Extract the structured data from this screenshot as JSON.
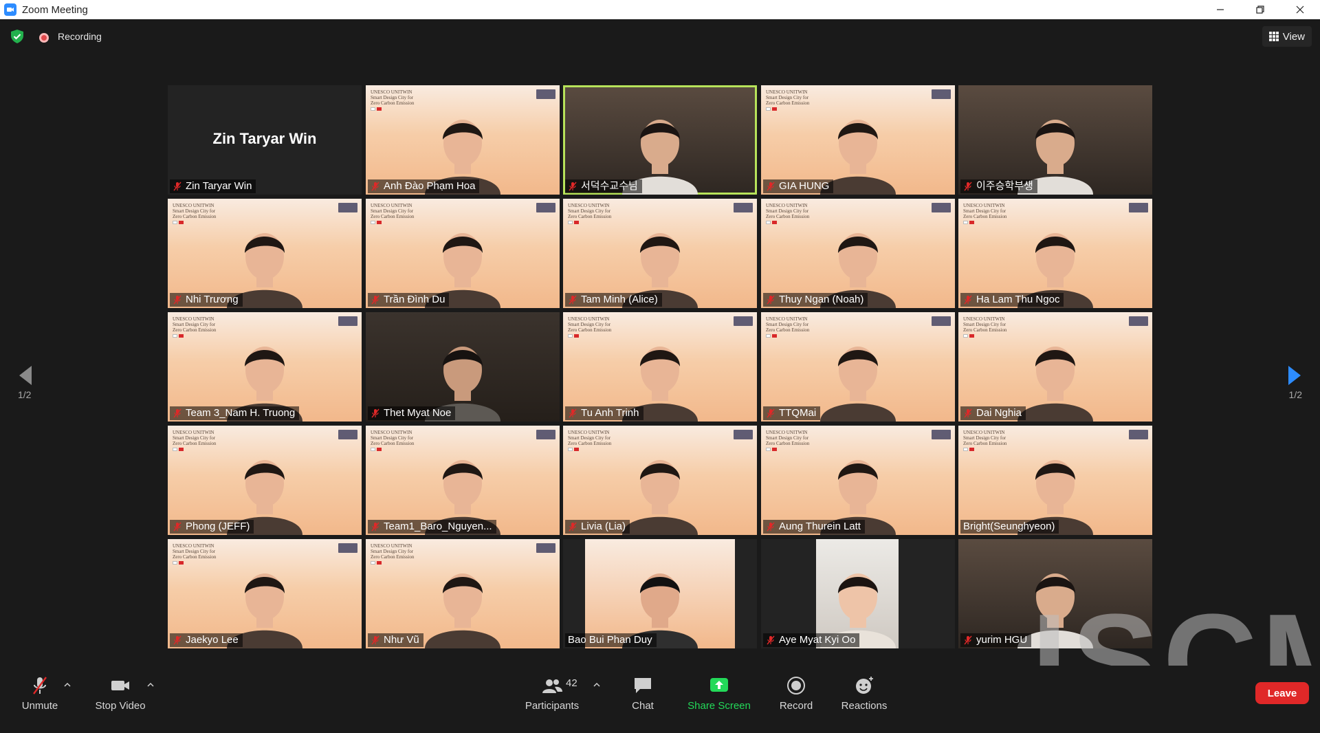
{
  "window": {
    "title": "Zoom Meeting"
  },
  "top": {
    "recording_label": "Recording",
    "view_label": "View"
  },
  "slide_text": "UNESCO UNITWIN\nSmart Design City for\nZero Carbon Emission",
  "pagination": {
    "left": "1/2",
    "right": "1/2"
  },
  "tiles": [
    {
      "name": "Zin Taryar Win",
      "kind": "name-only"
    },
    {
      "name": "Anh Đào Phạm Hoa",
      "kind": "slide"
    },
    {
      "name": "서덕수교수님",
      "kind": "room",
      "active": true
    },
    {
      "name": "GIA HUNG",
      "kind": "slide"
    },
    {
      "name": "이주승학부생",
      "kind": "room"
    },
    {
      "name": "Nhi Trương",
      "kind": "slide"
    },
    {
      "name": "Trần Đình Du",
      "kind": "slide"
    },
    {
      "name": "Tam Minh (Alice)",
      "kind": "slide"
    },
    {
      "name": "Thuy Ngan (Noah)",
      "kind": "slide"
    },
    {
      "name": "Ha Lam Thu Ngoc",
      "kind": "slide"
    },
    {
      "name": "Team 3_Nam H. Truong",
      "kind": "slide"
    },
    {
      "name": "Thet Myat Noe",
      "kind": "dark"
    },
    {
      "name": "Tu Anh Trinh",
      "kind": "slide"
    },
    {
      "name": "TTQMai",
      "kind": "slide"
    },
    {
      "name": "Dai Nghia",
      "kind": "slide"
    },
    {
      "name": "Phong (JEFF)",
      "kind": "slide"
    },
    {
      "name": "Team1_Baro_Nguyen...",
      "kind": "slide"
    },
    {
      "name": "Livia (Lia)",
      "kind": "slide"
    },
    {
      "name": "Aung Thurein Latt",
      "kind": "slide"
    },
    {
      "name": "Bright(Seunghyeon)",
      "kind": "slide",
      "no_mic": true
    },
    {
      "name": "Jaekyo Lee",
      "kind": "slide"
    },
    {
      "name": "Như Vũ",
      "kind": "slide"
    },
    {
      "name": "Bao Bui Phan Duy",
      "kind": "slide-narrow",
      "no_mic": true
    },
    {
      "name": "Aye Myat Kyi Oo",
      "kind": "light-narrow"
    },
    {
      "name": "yurim HGU",
      "kind": "room"
    }
  ],
  "toolbar": {
    "unmute": "Unmute",
    "stop_video": "Stop Video",
    "participants": "Participants",
    "participants_count": "42",
    "chat": "Chat",
    "share_screen": "Share Screen",
    "record": "Record",
    "reactions": "Reactions",
    "leave": "Leave"
  },
  "watermark": "ISCM",
  "colors": {
    "accent_green": "#23d959",
    "leave_red": "#e02828",
    "active_speaker": "#b7e35a",
    "recording": "#e0484b"
  }
}
